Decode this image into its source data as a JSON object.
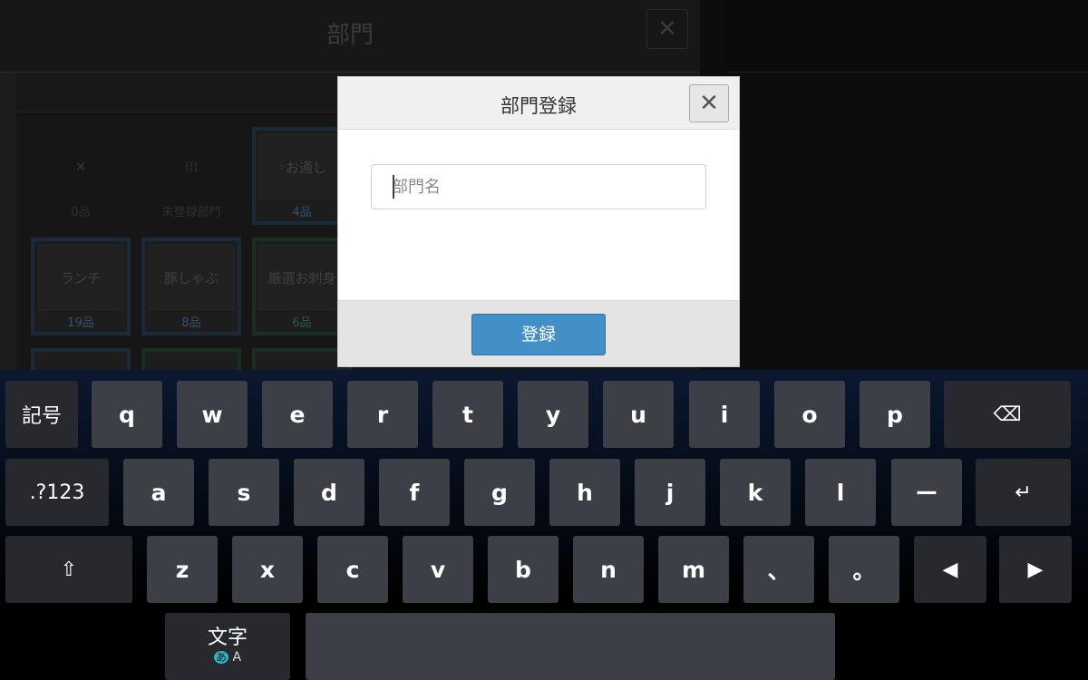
{
  "background": {
    "title": "部門",
    "close_glyph": "✕",
    "tiles": [
      {
        "label": "✕",
        "count": "0品",
        "style": "plain"
      },
      {
        "label": "⁞⁞⁞",
        "count": "未登録部門",
        "style": "plain"
      },
      {
        "label": "◦お通し",
        "count": "4品",
        "style": "blue"
      },
      {
        "label": "ランチ",
        "count": "19品",
        "style": "blue"
      },
      {
        "label": "豚しゃぶ",
        "count": "8品",
        "style": "blue"
      },
      {
        "label": "厳選お刺身",
        "count": "6品",
        "style": "green"
      }
    ]
  },
  "modal": {
    "title": "部門登録",
    "close_glyph": "✕",
    "name_input": {
      "value": "",
      "placeholder": "部門名"
    },
    "register_label": "登録"
  },
  "keyboard": {
    "row1": [
      "記号",
      "q",
      "w",
      "e",
      "r",
      "t",
      "y",
      "u",
      "i",
      "o",
      "p",
      "⌫"
    ],
    "row2": [
      ".?123",
      "a",
      "s",
      "d",
      "f",
      "g",
      "h",
      "j",
      "k",
      "l",
      "ー",
      "↵"
    ],
    "row3": [
      "⇧",
      "z",
      "x",
      "c",
      "v",
      "b",
      "n",
      "m",
      "、",
      "。",
      "◀",
      "▶"
    ],
    "mode_key": {
      "label": "文字",
      "sub_kana": "あ",
      "sub_latin": "A"
    },
    "space_label": ""
  }
}
